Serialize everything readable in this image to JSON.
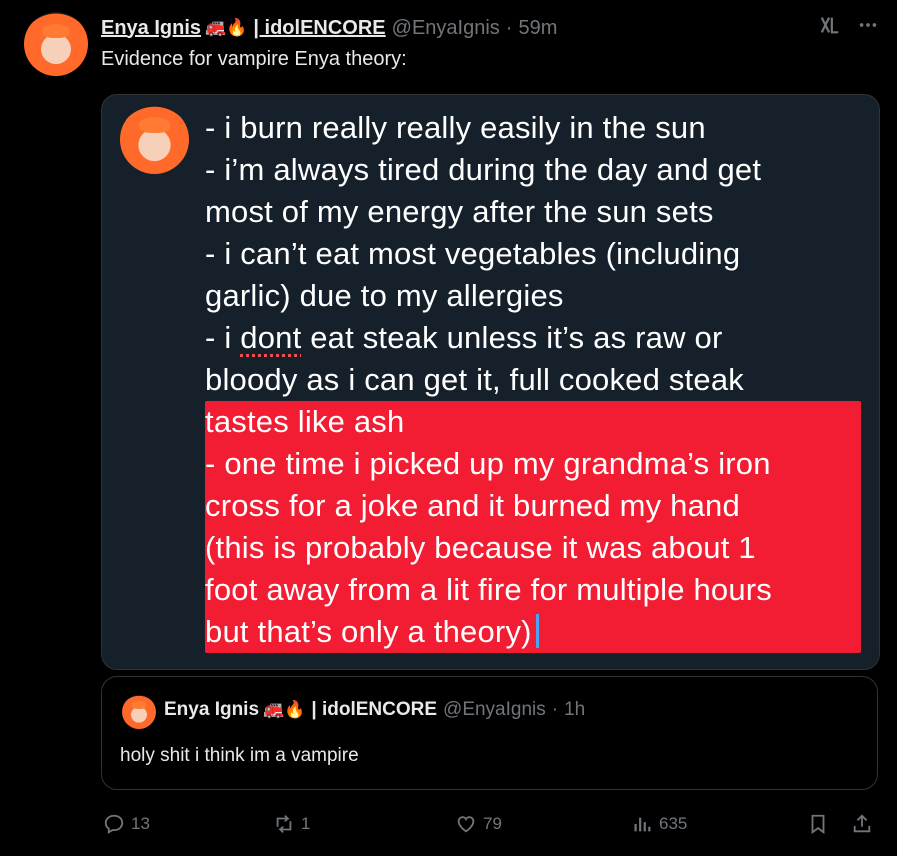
{
  "post": {
    "author_name": "Enya Ignis",
    "author_emojis": "🚒🔥",
    "author_suffix": "| idolENCORE",
    "handle": "@EnyaIgnis",
    "separator": "·",
    "time": "59m",
    "text": "Evidence for vampire Enya theory:",
    "more_icon": "ellipsis-icon",
    "grok_icon": "grok-icon"
  },
  "media": {
    "lines": [
      "- i burn really really easily in the sun",
      "- i’m always tired during the day and get",
      "most of my energy after the sun sets",
      "- i can’t eat most vegetables (including",
      "garlic) due to my allergies",
      "- i ",
      "dont",
      " eat steak unless it’s as raw or",
      "bloody as i can get it, full cooked steak",
      "tastes ",
      "like ash",
      "- one time i picked up my grandma’s iron",
      "cross for a joke and it burned my hand",
      "(this is probably because it was about 1",
      "foot away from a lit fire for multiple hours",
      "but that’s only a theory)"
    ],
    "highlight_color": "#f21c33"
  },
  "quote": {
    "author_name": "Enya Ignis",
    "author_emojis": "🚒🔥",
    "author_suffix": "| idolENCORE",
    "handle": "@EnyaIgnis",
    "separator": "·",
    "time": "1h",
    "text": "holy shit i think im a vampire"
  },
  "actions": {
    "replies": "13",
    "reposts": "1",
    "likes": "79",
    "views": "635"
  }
}
